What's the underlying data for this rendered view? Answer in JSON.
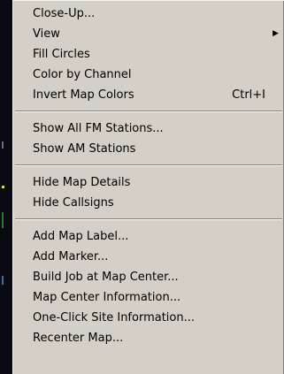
{
  "menu": {
    "group1": [
      {
        "label": "Close-Up...",
        "shortcut": "",
        "submenu": false
      },
      {
        "label": "View",
        "shortcut": "",
        "submenu": true
      },
      {
        "label": "Fill Circles",
        "shortcut": "",
        "submenu": false
      },
      {
        "label": "Color by Channel",
        "shortcut": "",
        "submenu": false
      },
      {
        "label": "Invert Map Colors",
        "shortcut": "Ctrl+I",
        "submenu": false
      }
    ],
    "group2": [
      {
        "label": "Show All FM Stations..."
      },
      {
        "label": "Show AM Stations"
      }
    ],
    "group3": [
      {
        "label": "Hide Map Details"
      },
      {
        "label": "Hide Callsigns"
      }
    ],
    "group4": [
      {
        "label": "Add Map Label..."
      },
      {
        "label": "Add Marker..."
      },
      {
        "label": "Build Job at Map Center..."
      },
      {
        "label": "Map Center Information..."
      },
      {
        "label": "One-Click Site Information..."
      },
      {
        "label": "Recenter Map..."
      }
    ]
  },
  "icons": {
    "submenu_arrow": "▶"
  },
  "colors": {
    "menu_bg": "#d4d0c8",
    "separator_dark": "#808080",
    "separator_light": "#ffffff"
  }
}
